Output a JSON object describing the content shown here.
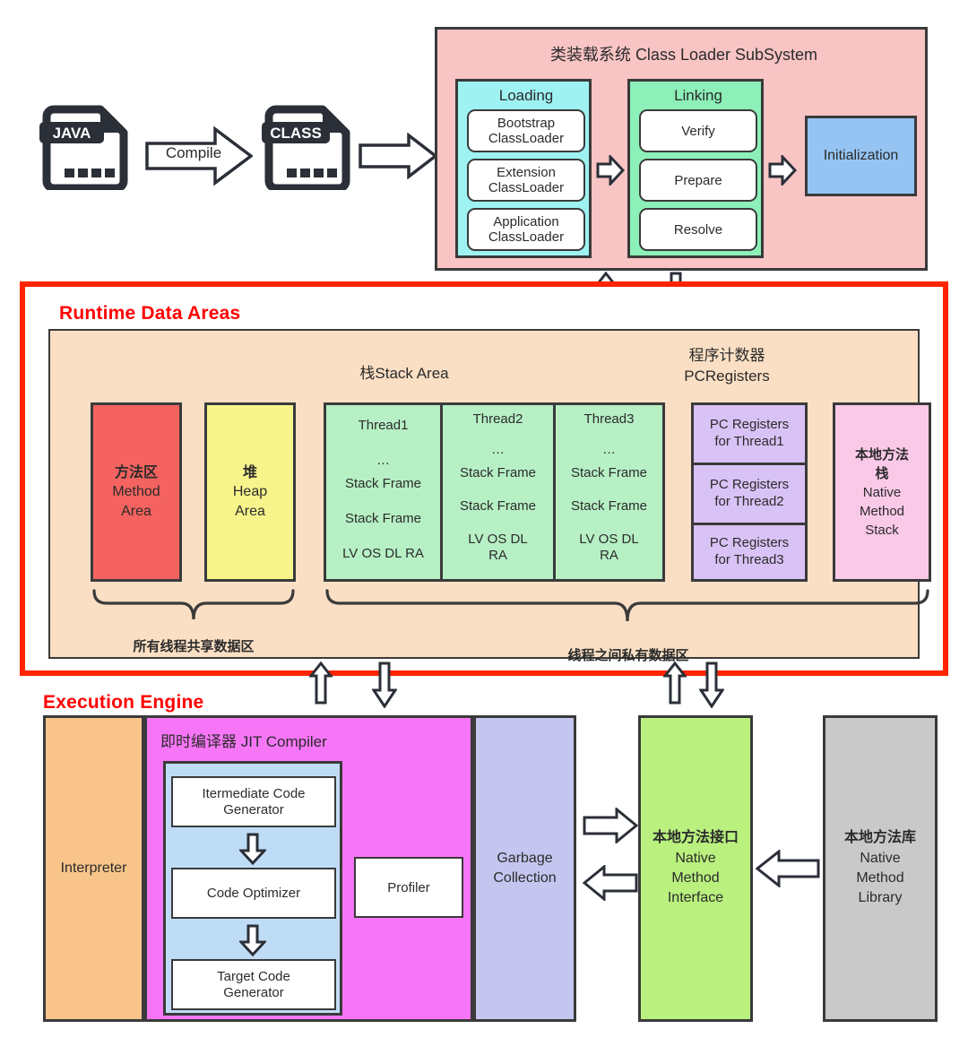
{
  "flow": {
    "java_file_label": "JAVA",
    "class_file_label": "CLASS",
    "compile_arrow_label": "Compile"
  },
  "class_loader": {
    "title": "类装载系统 Class Loader SubSystem",
    "loading": {
      "title": "Loading",
      "items": [
        "Bootstrap\nClassLoader",
        "Extension\nClassLoader",
        "Application\nClassLoader"
      ],
      "item_lines": [
        [
          "Bootstrap",
          "ClassLoader"
        ],
        [
          "Extension",
          "ClassLoader"
        ],
        [
          "Application",
          "ClassLoader"
        ]
      ],
      "color": "#9ef2f2"
    },
    "linking": {
      "title": "Linking",
      "items": [
        "Verify",
        "Prepare",
        "Resolve"
      ],
      "color": "#8cf0b8"
    },
    "initialization": {
      "label": "Initialization",
      "color": "#95c4f3"
    },
    "panel_color": "#f9c4c4"
  },
  "runtime_data_areas": {
    "title": "Runtime Data Areas",
    "title_color": "#ff0000",
    "panel_color": "#fadfc4",
    "border_color": "#ff2400",
    "headers": {
      "stack_area": "栈Stack Area",
      "pc_registers_line1": "程序计数器",
      "pc_registers_line2": "PCRegisters"
    },
    "method_area": {
      "lines": [
        "方法区",
        "Method",
        "Area"
      ],
      "color": "#f4635f"
    },
    "heap_area": {
      "lines": [
        "堆",
        "Heap",
        "Area"
      ],
      "color": "#f7f48b"
    },
    "threads": [
      {
        "name": "Thread1",
        "rows": [
          "…",
          "Stack Frame",
          "Stack Frame",
          "LV OS DL RA"
        ]
      },
      {
        "name": "Thread2",
        "rows": [
          "…",
          "Stack Frame",
          "Stack Frame",
          "LV OS DL RA"
        ]
      },
      {
        "name": "Thread3",
        "rows": [
          "…",
          "Stack Frame",
          "Stack Frame",
          "LV OS DL RA"
        ]
      }
    ],
    "thread_color": "#b6f0c4",
    "pc_registers": [
      [
        "PC Registers",
        "for Thread1"
      ],
      [
        "PC Registers",
        "for Thread2"
      ],
      [
        "PC Registers",
        "for Thread3"
      ]
    ],
    "pc_color": "#d9c2f5",
    "native_method_stack": {
      "lines": [
        "本地方法",
        "栈",
        "Native",
        "Method",
        "Stack"
      ],
      "color": "#fbc9e8"
    },
    "brace_shared_label": "所有线程共享数据区",
    "brace_private_label": "线程之间私有数据区"
  },
  "execution_engine": {
    "title": "Execution Engine",
    "title_color": "#ff0000",
    "interpreter": {
      "label": "Interpreter",
      "color": "#f8c48a"
    },
    "jit": {
      "title": "即时编译器 JIT Compiler",
      "color": "#f776f7",
      "inner_color": "#bfdcf7",
      "stages": [
        [
          "Itermediate Code",
          "Generator"
        ],
        [
          "Code Optimizer"
        ],
        [
          "Target Code",
          "Generator"
        ]
      ],
      "profiler_label": "Profiler"
    },
    "garbage_collection": {
      "lines": [
        "Garbage",
        "Collection"
      ],
      "color": "#c4c6f0"
    },
    "native_method_interface": {
      "lines": [
        "本地方法接口",
        "Native",
        "Method",
        "Interface"
      ],
      "color": "#b9f07e"
    },
    "native_method_library": {
      "lines": [
        "本地方法库",
        "Native",
        "Method",
        "Library"
      ],
      "color": "#c9c9c9"
    }
  }
}
